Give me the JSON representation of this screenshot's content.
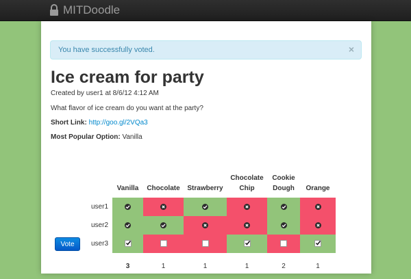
{
  "navbar": {
    "brand": "MITDoodle"
  },
  "alert": {
    "message": "You have successfully voted.",
    "close": "×"
  },
  "poll": {
    "title": "Ice cream for party",
    "created": "Created by user1 at 8/6/12 4:12 AM",
    "question": "What flavor of ice cream do you want at the party?",
    "short_link_label": "Short Link:",
    "short_link": "http://goo.gl/2VQa3",
    "popular_label": "Most Popular Option:",
    "popular_value": "Vanilla",
    "vote_button": "Vote",
    "options": [
      "Vanilla",
      "Chocolate",
      "Strawberry",
      "Chocolate Chip",
      "Cookie Dough",
      "Orange"
    ],
    "rows": [
      {
        "user": "user1",
        "votes": [
          true,
          false,
          true,
          false,
          true,
          false
        ]
      },
      {
        "user": "user2",
        "votes": [
          true,
          true,
          false,
          false,
          true,
          false
        ]
      },
      {
        "user": "user3",
        "votes": [
          true,
          false,
          false,
          true,
          false,
          true
        ],
        "editable": true
      }
    ],
    "totals": [
      "3",
      "1",
      "1",
      "1",
      "2",
      "1"
    ]
  },
  "colors": {
    "yes": "#92c47a",
    "no": "#f4506b",
    "background": "#92c47a"
  }
}
